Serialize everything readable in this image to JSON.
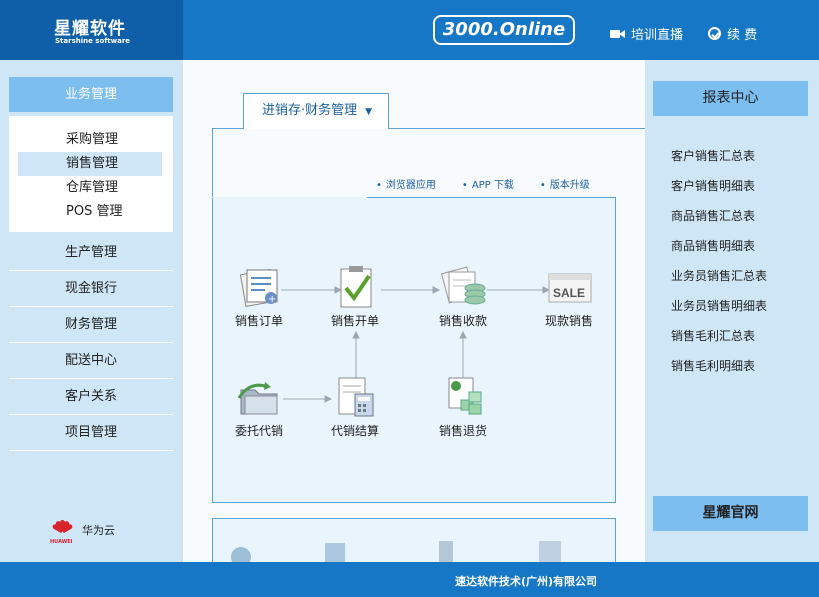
{
  "header": {
    "logo_title": "星耀软件",
    "logo_subtitle": "Starshine software",
    "online_badge": "3000.Online",
    "live_label": "培训直播",
    "renew_label": "续 费"
  },
  "left_sidebar": {
    "section_title": "业务管理",
    "sub_items": [
      "采购管理",
      "销售管理",
      "仓库管理",
      "POS 管理"
    ],
    "active_sub_item": "销售管理",
    "items": [
      "生产管理",
      "现金银行",
      "财务管理",
      "配送中心",
      "客户关系",
      "项目管理"
    ],
    "partner_label": "华为云",
    "partner_logo_text": "HUAWEI"
  },
  "main": {
    "tab_label": "进销存·财务管理",
    "links": [
      "浏览器应用",
      "APP 下载",
      "版本升级"
    ],
    "flow": {
      "sales_order": "销售订单",
      "sales_invoice": "销售开单",
      "sales_receipt": "销售收款",
      "cash_sale": "现款销售",
      "consignment": "委托代销",
      "consignment_settle": "代销结算",
      "sales_return": "销售退货"
    },
    "sale_icon_text": "SALE"
  },
  "right_sidebar": {
    "title": "报表中心",
    "items": [
      "客户销售汇总表",
      "客户销售明细表",
      "商品销售汇总表",
      "商品销售明细表",
      "业务员销售汇总表",
      "业务员销售明细表",
      "销售毛利汇总表",
      "销售毛利明细表"
    ],
    "official_site": "星耀官网"
  },
  "footer": {
    "company": "速达软件技术(广州)有限公司"
  },
  "colors": {
    "header_blue": "#1677c6",
    "logo_dark_blue": "#0e5fa8",
    "sidebar_bg": "#cfe6f7",
    "menu_title_bg": "#7dbef0",
    "panel_border": "#5aa3d8"
  }
}
